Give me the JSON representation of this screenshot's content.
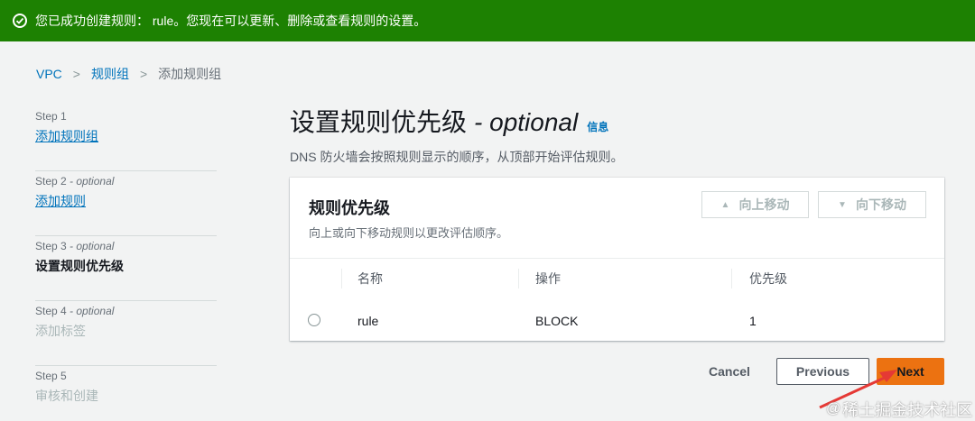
{
  "flash": {
    "message": "您已成功创建规则： rule。您现在可以更新、删除或查看规则的设置。",
    "icon": "check-circle-icon",
    "color": "#1d8102"
  },
  "breadcrumb": {
    "items": [
      "VPC",
      "规则组",
      "添加规则组"
    ],
    "separator": ">"
  },
  "steps": [
    {
      "num": "Step 1",
      "opt": "",
      "name": "添加规则组",
      "state": "link"
    },
    {
      "num": "Step 2",
      "opt": " - optional",
      "name": "添加规则",
      "state": "link"
    },
    {
      "num": "Step 3",
      "opt": " - optional",
      "name": "设置规则优先级",
      "state": "active"
    },
    {
      "num": "Step 4",
      "opt": " - optional",
      "name": "添加标签",
      "state": "disabled"
    },
    {
      "num": "Step 5",
      "opt": "",
      "name": "审核和创建",
      "state": "disabled"
    }
  ],
  "page": {
    "title": "设置规则优先级",
    "title_opt": "- optional",
    "info": "信息",
    "description": "DNS 防火墙会按照规则显示的顺序，从顶部开始评估规则。"
  },
  "panel": {
    "title": "规则优先级",
    "description": "向上或向下移动规则以更改评估顺序。",
    "move_up": "向上移动",
    "move_down": "向下移动",
    "columns": [
      "名称",
      "操作",
      "优先级"
    ],
    "rows": [
      {
        "name": "rule",
        "action": "BLOCK",
        "priority": "1"
      }
    ]
  },
  "actions": {
    "cancel": "Cancel",
    "previous": "Previous",
    "next": "Next",
    "accent": "#ec7211"
  },
  "watermark": {
    "at": "@",
    "text": "稀土掘金技术社区"
  }
}
